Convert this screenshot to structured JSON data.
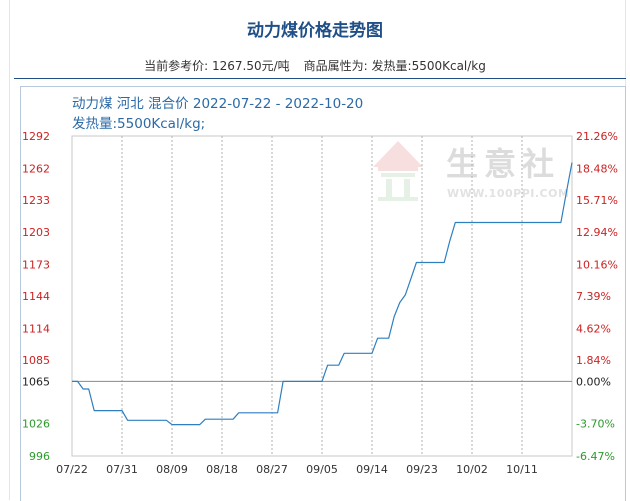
{
  "page": {
    "title": "动力煤价格走势图",
    "current_price_label": "当前参考价:",
    "current_price_value": "1267.50元/吨",
    "attribute_label": "商品属性为:",
    "attribute_value": "发热量:5500Kcal/kg"
  },
  "chart_data": {
    "type": "line",
    "title_line1": "动力煤 河北 混合价 2022-07-22 - 2022-10-20",
    "title_line2": "发热量:5500Kcal/kg;",
    "watermark": {
      "chinese": "生意社",
      "url": "WWW.100PPI.COM"
    },
    "y_left_ticks": [
      {
        "label": "1292",
        "value": 1292,
        "color": "#cc2222"
      },
      {
        "label": "1262",
        "value": 1262,
        "color": "#cc2222"
      },
      {
        "label": "1233",
        "value": 1233,
        "color": "#cc2222"
      },
      {
        "label": "1203",
        "value": 1203,
        "color": "#cc2222"
      },
      {
        "label": "1173",
        "value": 1173,
        "color": "#cc2222"
      },
      {
        "label": "1144",
        "value": 1144,
        "color": "#cc2222"
      },
      {
        "label": "1114",
        "value": 1114,
        "color": "#cc2222"
      },
      {
        "label": "1085",
        "value": 1085,
        "color": "#cc2222"
      },
      {
        "label": "1065",
        "value": 1065,
        "color": "#222222"
      },
      {
        "label": "1026",
        "value": 1026,
        "color": "#2a9a2a"
      },
      {
        "label": "996",
        "value": 996,
        "color": "#2a9a2a"
      }
    ],
    "y_right_ticks": [
      {
        "label": "21.26%",
        "value": 1292,
        "color": "#cc2222"
      },
      {
        "label": "18.48%",
        "value": 1262,
        "color": "#cc2222"
      },
      {
        "label": "15.71%",
        "value": 1233,
        "color": "#cc2222"
      },
      {
        "label": "12.94%",
        "value": 1203,
        "color": "#cc2222"
      },
      {
        "label": "10.16%",
        "value": 1173,
        "color": "#cc2222"
      },
      {
        "label": "7.39%",
        "value": 1144,
        "color": "#cc2222"
      },
      {
        "label": "4.62%",
        "value": 1114,
        "color": "#cc2222"
      },
      {
        "label": "1.84%",
        "value": 1085,
        "color": "#cc2222"
      },
      {
        "label": "0.00%",
        "value": 1065,
        "color": "#222222"
      },
      {
        "label": "-3.70%",
        "value": 1026,
        "color": "#2a9a2a"
      },
      {
        "label": "-6.47%",
        "value": 996,
        "color": "#2a9a2a"
      }
    ],
    "ylim": [
      996,
      1292
    ],
    "baseline": 1065,
    "x_range": [
      "2022-07-22",
      "2022-10-20"
    ],
    "x_ticks": [
      {
        "label": "07/22",
        "date": "2022-07-22"
      },
      {
        "label": "07/31",
        "date": "2022-07-31"
      },
      {
        "label": "08/09",
        "date": "2022-08-09"
      },
      {
        "label": "08/18",
        "date": "2022-08-18"
      },
      {
        "label": "08/27",
        "date": "2022-08-27"
      },
      {
        "label": "09/05",
        "date": "2022-09-05"
      },
      {
        "label": "09/14",
        "date": "2022-09-14"
      },
      {
        "label": "09/23",
        "date": "2022-09-23"
      },
      {
        "label": "10/02",
        "date": "2022-10-02"
      },
      {
        "label": "10/11",
        "date": "2022-10-11"
      }
    ],
    "grid": true,
    "line_color": "#2f7fc0",
    "series": [
      {
        "points": [
          [
            "2022-07-22",
            1065
          ],
          [
            "2022-07-23",
            1065
          ],
          [
            "2022-07-24",
            1058
          ],
          [
            "2022-07-25",
            1058
          ],
          [
            "2022-07-26",
            1038
          ],
          [
            "2022-07-27",
            1038
          ],
          [
            "2022-07-28",
            1038
          ],
          [
            "2022-07-29",
            1038
          ],
          [
            "2022-07-30",
            1038
          ],
          [
            "2022-07-31",
            1038
          ],
          [
            "2022-08-01",
            1029
          ],
          [
            "2022-08-02",
            1029
          ],
          [
            "2022-08-03",
            1029
          ],
          [
            "2022-08-04",
            1029
          ],
          [
            "2022-08-05",
            1029
          ],
          [
            "2022-08-06",
            1029
          ],
          [
            "2022-08-07",
            1029
          ],
          [
            "2022-08-08",
            1029
          ],
          [
            "2022-08-09",
            1025
          ],
          [
            "2022-08-10",
            1025
          ],
          [
            "2022-08-11",
            1025
          ],
          [
            "2022-08-12",
            1025
          ],
          [
            "2022-08-13",
            1025
          ],
          [
            "2022-08-14",
            1025
          ],
          [
            "2022-08-15",
            1030
          ],
          [
            "2022-08-16",
            1030
          ],
          [
            "2022-08-17",
            1030
          ],
          [
            "2022-08-18",
            1030
          ],
          [
            "2022-08-19",
            1030
          ],
          [
            "2022-08-20",
            1030
          ],
          [
            "2022-08-21",
            1036
          ],
          [
            "2022-08-22",
            1036
          ],
          [
            "2022-08-23",
            1036
          ],
          [
            "2022-08-24",
            1036
          ],
          [
            "2022-08-25",
            1036
          ],
          [
            "2022-08-26",
            1036
          ],
          [
            "2022-08-27",
            1036
          ],
          [
            "2022-08-28",
            1036
          ],
          [
            "2022-08-29",
            1065
          ],
          [
            "2022-08-30",
            1065
          ],
          [
            "2022-08-31",
            1065
          ],
          [
            "2022-09-01",
            1065
          ],
          [
            "2022-09-02",
            1065
          ],
          [
            "2022-09-03",
            1065
          ],
          [
            "2022-09-04",
            1065
          ],
          [
            "2022-09-05",
            1065
          ],
          [
            "2022-09-06",
            1080
          ],
          [
            "2022-09-07",
            1080
          ],
          [
            "2022-09-08",
            1080
          ],
          [
            "2022-09-09",
            1091
          ],
          [
            "2022-09-10",
            1091
          ],
          [
            "2022-09-11",
            1091
          ],
          [
            "2022-09-12",
            1091
          ],
          [
            "2022-09-13",
            1091
          ],
          [
            "2022-09-14",
            1091
          ],
          [
            "2022-09-15",
            1105
          ],
          [
            "2022-09-16",
            1105
          ],
          [
            "2022-09-17",
            1105
          ],
          [
            "2022-09-18",
            1125
          ],
          [
            "2022-09-19",
            1138
          ],
          [
            "2022-09-20",
            1145
          ],
          [
            "2022-09-21",
            1160
          ],
          [
            "2022-09-22",
            1175
          ],
          [
            "2022-09-23",
            1175
          ],
          [
            "2022-09-24",
            1175
          ],
          [
            "2022-09-25",
            1175
          ],
          [
            "2022-09-26",
            1175
          ],
          [
            "2022-09-27",
            1175
          ],
          [
            "2022-09-28",
            1195
          ],
          [
            "2022-09-29",
            1212
          ],
          [
            "2022-09-30",
            1212
          ],
          [
            "2022-10-01",
            1212
          ],
          [
            "2022-10-02",
            1212
          ],
          [
            "2022-10-03",
            1212
          ],
          [
            "2022-10-04",
            1212
          ],
          [
            "2022-10-05",
            1212
          ],
          [
            "2022-10-06",
            1212
          ],
          [
            "2022-10-07",
            1212
          ],
          [
            "2022-10-08",
            1212
          ],
          [
            "2022-10-09",
            1212
          ],
          [
            "2022-10-10",
            1212
          ],
          [
            "2022-10-11",
            1212
          ],
          [
            "2022-10-12",
            1212
          ],
          [
            "2022-10-13",
            1212
          ],
          [
            "2022-10-14",
            1212
          ],
          [
            "2022-10-15",
            1212
          ],
          [
            "2022-10-16",
            1212
          ],
          [
            "2022-10-17",
            1212
          ],
          [
            "2022-10-18",
            1212
          ],
          [
            "2022-10-19",
            1240
          ],
          [
            "2022-10-20",
            1267.5
          ]
        ]
      }
    ]
  }
}
